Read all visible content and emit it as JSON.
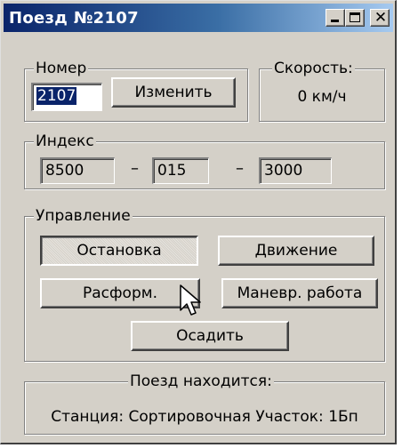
{
  "window": {
    "title": "Поезд №2107"
  },
  "number_group": {
    "legend": "Номер",
    "value": "2107",
    "change_button": "Изменить"
  },
  "speed_group": {
    "legend": "Скорость:",
    "value": "0 км/ч"
  },
  "index_group": {
    "legend": "Индекс",
    "part1": "8500",
    "part2": "015",
    "part3": "3000",
    "separator": "–"
  },
  "control_group": {
    "legend": "Управление",
    "stop_button": "Остановка",
    "move_button": "Движение",
    "disband_button": "Расформ.",
    "shunt_button": "Маневр. работа",
    "settle_button": "Осадить"
  },
  "location_group": {
    "legend": "Поезд находится:",
    "text": "Станция: Сортировочная Участок: 1Бп"
  },
  "icons": [
    "minimize-icon",
    "maximize-icon",
    "close-icon",
    "mouse-pointer-icon"
  ]
}
